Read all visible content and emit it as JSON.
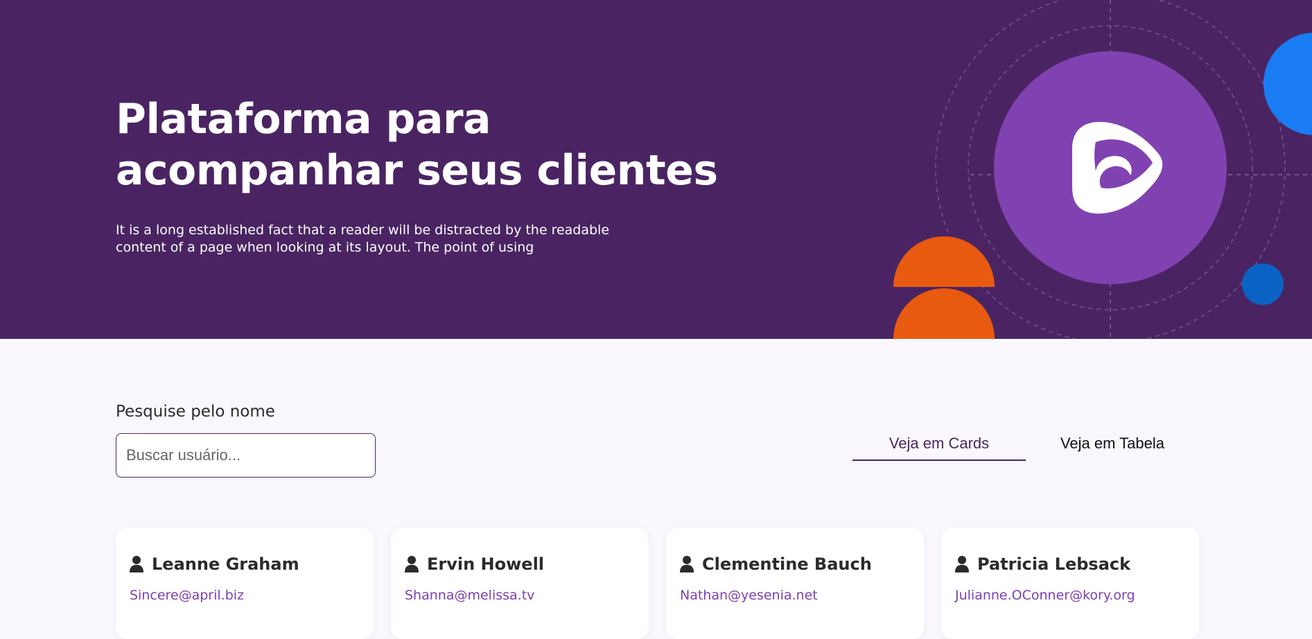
{
  "hero": {
    "title_line1": "Plataforma para",
    "title_line2": "acompanhar seus clientes",
    "subtitle": "It is a long established fact that a reader will be distracted by the readable content of a page when looking at its layout. The point of using"
  },
  "search": {
    "label": "Pesquise pelo nome",
    "placeholder": "Buscar usuário..."
  },
  "view_toggle": {
    "cards_label": "Veja em Cards",
    "table_label": "Veja em Tabela",
    "active": "cards"
  },
  "users": [
    {
      "name": "Leanne Graham",
      "email": "Sincere@april.biz"
    },
    {
      "name": "Ervin Howell",
      "email": "Shanna@melissa.tv"
    },
    {
      "name": "Clementine Bauch",
      "email": "Nathan@yesenia.net"
    },
    {
      "name": "Patricia Lebsack",
      "email": "Julianne.OConner@kory.org"
    }
  ],
  "colors": {
    "hero_bg": "#4a2462",
    "accent_purple": "#8142b1",
    "orange": "#e85a0f",
    "blue": "#1a7cf2",
    "email_link": "#7b3fb3"
  },
  "icons": [
    "logo-icon",
    "user-icon"
  ]
}
